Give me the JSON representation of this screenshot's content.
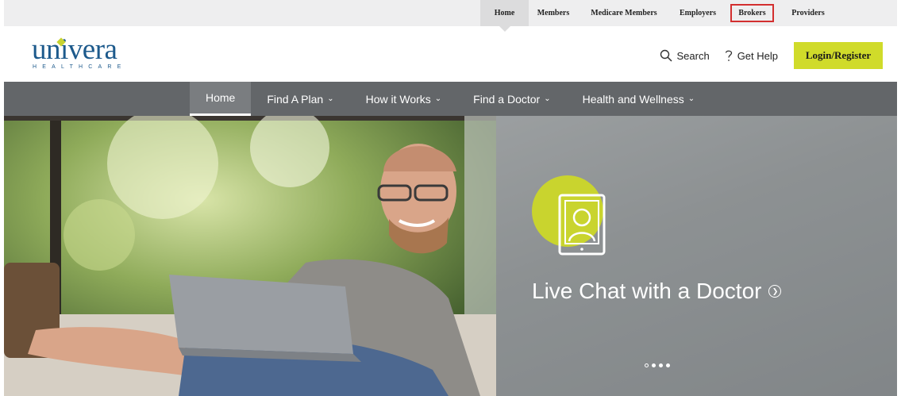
{
  "top_nav": {
    "items": [
      {
        "label": "Home",
        "active": true
      },
      {
        "label": "Members"
      },
      {
        "label": "Medicare Members"
      },
      {
        "label": "Employers"
      },
      {
        "label": "Brokers",
        "highlighted": true
      },
      {
        "label": "Providers"
      }
    ]
  },
  "logo": {
    "word": "univera",
    "sub": "HEALTHCARE"
  },
  "header": {
    "search_label": "Search",
    "help_label": "Get Help",
    "login_label": "Login/Register"
  },
  "main_nav": {
    "items": [
      {
        "label": "Home",
        "active": true
      },
      {
        "label": "Find A Plan",
        "dropdown": true
      },
      {
        "label": "How it Works",
        "dropdown": true
      },
      {
        "label": "Find a Doctor",
        "dropdown": true
      },
      {
        "label": "Health and Wellness",
        "dropdown": true
      }
    ]
  },
  "hero": {
    "title": "Live Chat with a Doctor",
    "icon": "tablet-doctor-icon",
    "slides": 4,
    "active_slide": 1
  },
  "colors": {
    "brand": "#1d5a8c",
    "accent": "#d0db2a",
    "nav_bg": "#636669",
    "highlight_border": "#d32f2f"
  }
}
